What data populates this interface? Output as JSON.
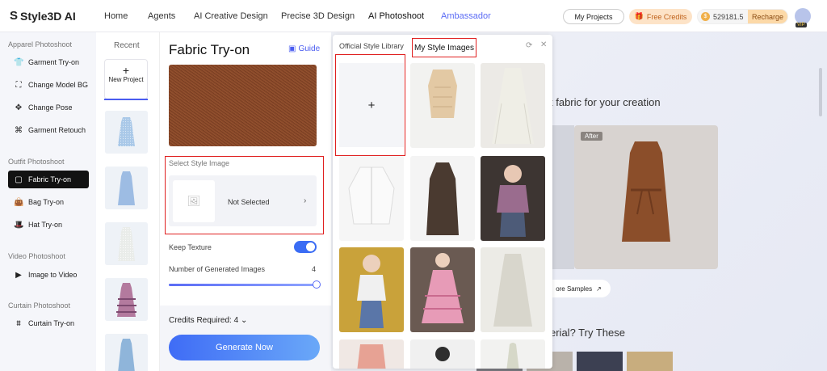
{
  "app": {
    "logo": "Style3D AI"
  },
  "nav": {
    "items": [
      "Home",
      "Agents",
      "AI Creative Design",
      "Precise 3D Design",
      "AI Photoshoot",
      "Ambassador"
    ]
  },
  "header": {
    "my_projects": "My Projects",
    "free_credits": "Free Credits",
    "credits_balance": "529181.5",
    "recharge": "Recharge",
    "vip": "VIP"
  },
  "sidebar": {
    "sections": [
      {
        "title": "Apparel Photoshoot",
        "items": [
          "Garment Try-on",
          "Change Model BG",
          "Change Pose",
          "Garment Retouch"
        ]
      },
      {
        "title": "Outfit Photoshoot",
        "items": [
          "Fabric Try-on",
          "Bag Try-on",
          "Hat Try-on"
        ]
      },
      {
        "title": "Video Photoshoot",
        "items": [
          "Image to Video"
        ]
      },
      {
        "title": "Curtain Photoshoot",
        "items": [
          "Curtain Try-on"
        ]
      }
    ],
    "active": "Fabric Try-on"
  },
  "recent": {
    "title": "Recent",
    "new_project": "New Project",
    "plus": "+"
  },
  "panel": {
    "title": "Fabric Try-on",
    "guide": "Guide",
    "select_style_label": "Select Style Image",
    "not_selected": "Not Selected",
    "keep_texture": "Keep Texture",
    "keep_texture_on": true,
    "num_images_label": "Number of Generated Images",
    "num_images_value": "4",
    "credits_required": "Credits Required: 4",
    "generate": "Generate Now"
  },
  "library": {
    "tab_official": "Official Style Library",
    "tab_mine": "My Style Images",
    "upload_plus": "+"
  },
  "background": {
    "headline_fragment": "t fabric for your creation",
    "after_tag": "After",
    "more_samples": "ore Samples",
    "headline2_fragment": "erial? Try These"
  },
  "colors": {
    "accent": "#4a5cf0",
    "highlight_border": "#e02020",
    "active_nav_bg": "#121212"
  }
}
